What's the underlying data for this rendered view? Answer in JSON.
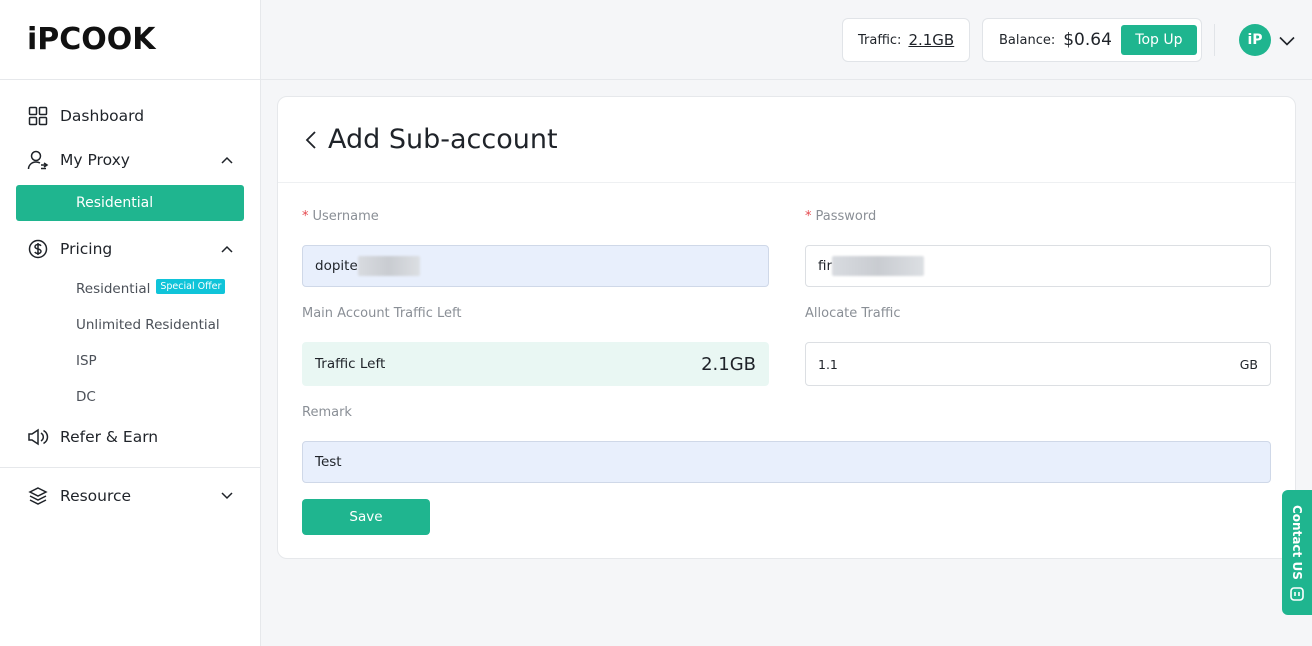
{
  "brand": {
    "logo": "iPCOOK",
    "accent": "#1fb58f"
  },
  "sidebar": {
    "dashboard": "Dashboard",
    "my_proxy": "My Proxy",
    "my_proxy_active": "Residential",
    "pricing": "Pricing",
    "pricing_items": [
      "Residential",
      "Unlimited Residential",
      "ISP",
      "DC"
    ],
    "special_offer": "Special Offer",
    "refer": "Refer & Earn",
    "resource": "Resource"
  },
  "header": {
    "traffic_label": "Traffic:",
    "traffic_value": "2.1GB",
    "balance_label": "Balance:",
    "balance_value": "$0.64",
    "topup": "Top Up",
    "avatar": "iP"
  },
  "form": {
    "title": "Add Sub-account",
    "username_label": "Username",
    "username_value": "dopite",
    "password_label": "Password",
    "password_value": "fir",
    "main_traffic_label": "Main Account Traffic Left",
    "traffic_left_label": "Traffic Left",
    "traffic_left_value": "2.1GB",
    "allocate_label": "Allocate Traffic",
    "allocate_value": "1.1",
    "allocate_unit": "GB",
    "remark_label": "Remark",
    "remark_value": "Test",
    "save": "Save"
  },
  "contact": "Contact US"
}
